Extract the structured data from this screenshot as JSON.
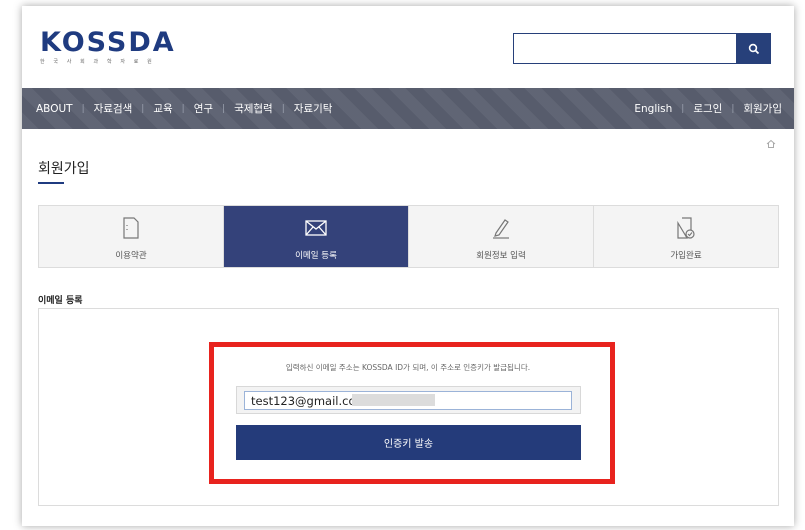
{
  "logo": {
    "text": "KOSSDA",
    "sub": "한 국 사 회 과 학 자 료 원"
  },
  "search": {
    "value": "",
    "button_icon": "search-icon"
  },
  "nav": {
    "left": [
      "ABOUT",
      "자료검색",
      "교육",
      "연구",
      "국제협력",
      "자료기탁"
    ],
    "right": [
      "English",
      "로그인",
      "회원가입"
    ]
  },
  "page_title": "회원가입",
  "steps": [
    {
      "label": "이용약관",
      "icon": "document-icon",
      "active": false
    },
    {
      "label": "이메일 등록",
      "icon": "envelope-icon",
      "active": true
    },
    {
      "label": "회원정보 입력",
      "icon": "pencil-icon",
      "active": false
    },
    {
      "label": "가입완료",
      "icon": "document-check-icon",
      "active": false
    }
  ],
  "section_title": "이메일 등록",
  "form": {
    "notice": "입력하신 이메일 주소는 KOSSDA ID가 되며, 이 주소로 인증키가 발급됩니다.",
    "email_value": "test123@gmail.com",
    "submit_label": "인증키 발송"
  },
  "colors": {
    "brand": "#1f3b80",
    "nav_bg": "#5a5f6f",
    "active_step": "#34427a",
    "button": "#243b7a",
    "highlight_box": "#e8231e"
  }
}
